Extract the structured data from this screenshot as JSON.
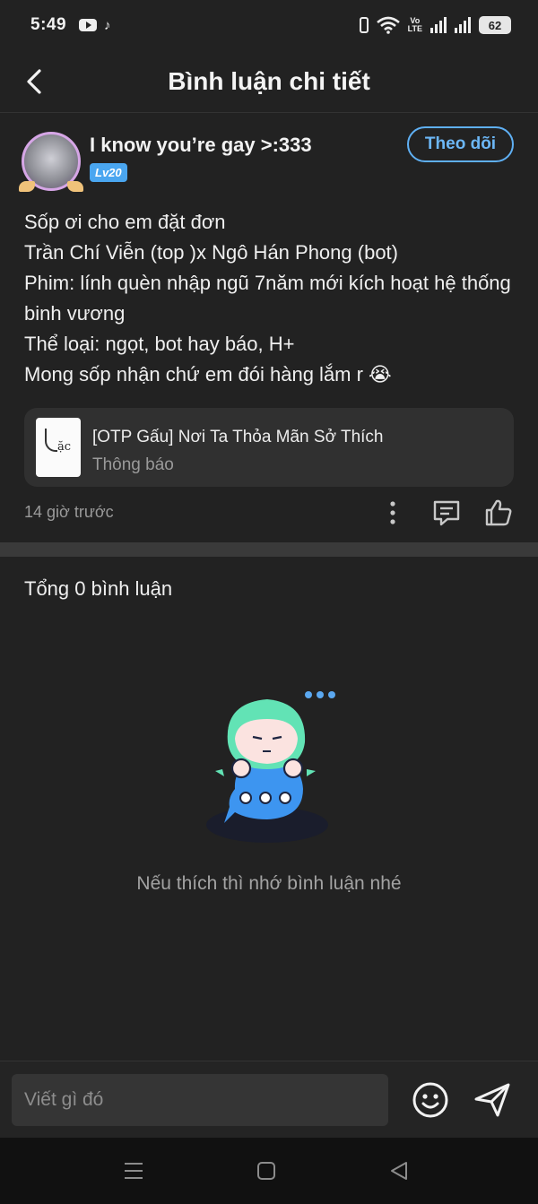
{
  "status_bar": {
    "time": "5:49",
    "network_label_top": "Vo",
    "network_label_bottom": "LTE",
    "battery": "62",
    "icons": [
      "youtube-icon",
      "tiktok-icon",
      "vibrate-icon",
      "wifi-icon",
      "signal-icon",
      "battery-icon"
    ]
  },
  "header": {
    "title": "Bình luận chi tiết",
    "back_icon": "chevron-left-icon"
  },
  "post": {
    "author": "I know you’re gay >:333",
    "level": "Lv20",
    "follow_label": "Theo dõi",
    "content_lines": [
      "Sốp ơi cho em đặt đơn",
      "Trần Chí Viễn (top )x Ngô Hán Phong (bot)",
      "Phim: lính quèn nhập ngũ 7năm mới kích hoạt hệ thống binh vương",
      "Thể loại: ngọt, bot hay báo, H+",
      "Mong sốp nhận chứ em đói hàng lắm r 😭"
    ],
    "link_card": {
      "thumb_text": "ặc",
      "title": "[OTP Gấu] Nơi Ta Thỏa Mãn Sở Thích",
      "subtitle": "Thông báo"
    },
    "time_ago": "14 giờ trước"
  },
  "comments": {
    "total_label": "Tổng 0 bình luận",
    "empty_text": "Nếu thích thì nhớ bình luận nhé"
  },
  "composer": {
    "placeholder": "Viết gì đó"
  },
  "colors": {
    "background": "#222222",
    "accent": "#5fb0f4",
    "level_badge": "#4aa6f0"
  }
}
